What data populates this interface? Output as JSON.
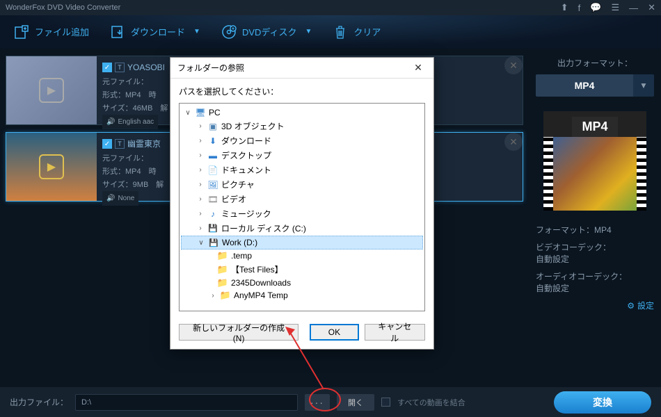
{
  "titlebar": {
    "title": "WonderFox DVD Video Converter"
  },
  "toolbar": {
    "add_file": "ファイル追加",
    "download": "ダウンロード",
    "dvd_disc": "DVDディスク",
    "clear": "クリア"
  },
  "files": [
    {
      "title": "YOASOBI「...",
      "source": "元ファイル：",
      "format": "形式：MP4　時",
      "size": "サイズ：46MB　解",
      "audio": "English aac"
    },
    {
      "title": "幽霊東京",
      "source": "元ファイル：",
      "format": "形式：MP4　時",
      "size": "サイズ：9MB　解",
      "audio": "None"
    }
  ],
  "right": {
    "format_label": "出力フォーマット：",
    "format_value": "MP4",
    "preview_badge": "MP4",
    "format_info": "フォーマット：MP4",
    "video_codec_label": "ビデオコーデック：",
    "video_codec_value": "自動設定",
    "audio_codec_label": "オーディオコーデック：",
    "audio_codec_value": "自動設定",
    "settings": "設定"
  },
  "bottom": {
    "output_label": "出力ファイル：",
    "output_path": "D:\\",
    "open": "開く",
    "merge_all": "すべての動画を結合",
    "convert": "変換"
  },
  "dialog": {
    "title": "フォルダーの参照",
    "prompt": "パスを選択してください：",
    "pc": "PC",
    "items": {
      "3d_objects": "3D オブジェクト",
      "downloads": "ダウンロード",
      "desktop": "デスクトップ",
      "documents": "ドキュメント",
      "pictures": "ピクチャ",
      "videos": "ビデオ",
      "music": "ミュージック",
      "local_disk_c": "ローカル ディスク (C:)",
      "work_d": "Work (D:)",
      "temp": ".temp",
      "test_files": "【Test Files】",
      "downloads2345": "2345Downloads",
      "anymp4": "AnyMP4 Temp"
    },
    "new_folder": "新しいフォルダーの作成(N)",
    "ok": "OK",
    "cancel": "キャンセル"
  }
}
